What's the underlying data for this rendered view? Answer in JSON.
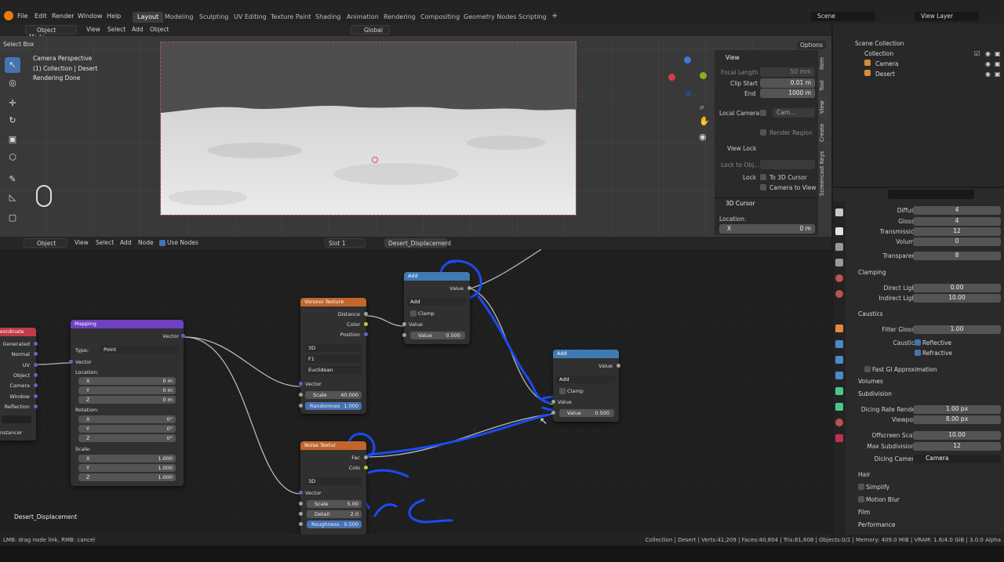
{
  "menu": [
    "File",
    "Edit",
    "Render",
    "Window",
    "Help"
  ],
  "workspaces": [
    "Layout",
    "Modeling",
    "Sculpting",
    "UV Editing",
    "Texture Paint",
    "Shading",
    "Animation",
    "Rendering",
    "Compositing",
    "Geometry Nodes",
    "Scripting"
  ],
  "active_workspace": "Layout",
  "scene": "Scene",
  "view_layer": "View Layer",
  "viewport_header": {
    "select_box": "Select Box",
    "mode": "Object Mode",
    "menus": [
      "View",
      "Select",
      "Add",
      "Object"
    ],
    "orientation": "Global",
    "options": "Options"
  },
  "viewport_overlay": {
    "line1": "Camera Perspective",
    "line2": "(1) Collection | Desert",
    "line3": "Rendering Done"
  },
  "npanel": {
    "view_title": "View",
    "focal_length_label": "Focal Length",
    "focal_length": "50 mm",
    "clip_start_label": "Clip Start",
    "clip_start": "0.01 m",
    "end_label": "End",
    "end": "1000 m",
    "local_camera_label": "Local Camera",
    "local_camera_value": "Cam...",
    "render_region": "Render Region",
    "view_lock": "View Lock",
    "lock_to_obj": "Lock to Obj...",
    "lock_label": "Lock",
    "to_3d_cursor": "To 3D Cursor",
    "camera_to_view": "Camera to View",
    "cursor_title": "3D Cursor",
    "location_label": "Location:",
    "x_label": "X",
    "x_value": "0 m",
    "tabs": [
      "Item",
      "Tool",
      "View",
      "Create",
      "Screencast Keys"
    ]
  },
  "outliner": {
    "scene_collection": "Scene Collection",
    "collection": "Collection",
    "camera": "Camera",
    "desert": "Desert"
  },
  "node_header": {
    "object": "Object",
    "menus": [
      "View",
      "Select",
      "Add",
      "Node"
    ],
    "use_nodes": "Use Nodes",
    "slot": "Slot 1",
    "material": "Desert_Displacement"
  },
  "nodes": {
    "coord": {
      "title": "Coordinate",
      "outputs": [
        "Generated",
        "Normal",
        "UV",
        "Object",
        "Camera",
        "Window",
        "Reflection"
      ],
      "instancer": "nstancer"
    },
    "mapping": {
      "title": "Mapping",
      "vector_out": "Vector",
      "type_label": "Type:",
      "type": "Point",
      "vector_in": "Vector",
      "location": "Location:",
      "rotation": "Rotation:",
      "scale": "Scale:",
      "loc": [
        "0 m",
        "0 m",
        "0 m"
      ],
      "rot": [
        "0°",
        "0°",
        "0°"
      ],
      "scl": [
        "1.000",
        "1.000",
        "1.000"
      ],
      "axes": [
        "X",
        "Y",
        "Z"
      ]
    },
    "voronoi": {
      "title": "Voronoi Texture",
      "outputs": [
        "Distance",
        "Color",
        "Position"
      ],
      "dim": "3D",
      "feature": "F1",
      "metric": "Euclidean",
      "vector": "Vector",
      "scale_label": "Scale",
      "scale": "40.000",
      "rand_label": "Randomnes",
      "rand": "1.000"
    },
    "add1": {
      "title": "Add",
      "value_out": "Value",
      "op": "Add",
      "clamp": "Clamp",
      "value_in": "Value",
      "value2_label": "Value",
      "value2": "0.500"
    },
    "add2": {
      "title": "Add",
      "value_out": "Value",
      "op": "Add",
      "clamp": "Clamp",
      "value_in": "Value",
      "value2_label": "Value",
      "value2": "0.500"
    },
    "noise": {
      "title": "Noise Textur",
      "fac": "Fac",
      "color": "Colo",
      "dim": "3D",
      "vector": "Vector",
      "scale_label": "Scale",
      "scale": "5.00",
      "detail_label": "Detail",
      "detail": "2.0",
      "rough_label": "Roughness",
      "rough": "0.500"
    }
  },
  "material_label": "Desert_Displacement",
  "properties": {
    "bounces": [
      {
        "label": "Diffuse",
        "value": "4"
      },
      {
        "label": "Glossy",
        "value": "4"
      },
      {
        "label": "Transmission",
        "value": "12"
      },
      {
        "label": "Volume",
        "value": "0"
      },
      {
        "label": "Transparent",
        "value": "8"
      }
    ],
    "clamping": "Clamping",
    "direct_light_label": "Direct Light",
    "direct_light": "0.00",
    "indirect_light_label": "Indirect Light",
    "indirect_light": "10.00",
    "caustics": "Caustics",
    "filter_glossy_label": "Filter Glossy",
    "filter_glossy": "1.00",
    "caustics_label": "Caustics",
    "reflective": "Reflective",
    "refractive": "Refractive",
    "fast_gi": "Fast GI Approximation",
    "volumes": "Volumes",
    "subdivision": "Subdivision",
    "dicing_rate_label": "Dicing Rate Render",
    "dicing_rate": "1.00 px",
    "viewport_label": "Viewport",
    "viewport": "8.00 px",
    "offscreen_label": "Offscreen Scale",
    "offscreen": "10.00",
    "max_subdiv_label": "Max Subdivisions",
    "max_subdiv": "12",
    "dicing_camera_label": "Dicing Camera",
    "dicing_camera": "Camera",
    "sections": [
      "Hair",
      "Simplify",
      "Motion Blur",
      "Film",
      "Performance"
    ]
  },
  "status": {
    "left": "LMB: drag node link, RMB: cancel",
    "right": "Collection | Desert | Verts:41,209 | Faces:40,804 | Tris:81,608 | Objects:0/2 | Memory: 409.0 MiB | VRAM: 1.6/4.0 GiB | 3.0.0 Alpha"
  },
  "colors": {
    "accent": "#4772b3",
    "annotation": "#1a4cf2"
  }
}
